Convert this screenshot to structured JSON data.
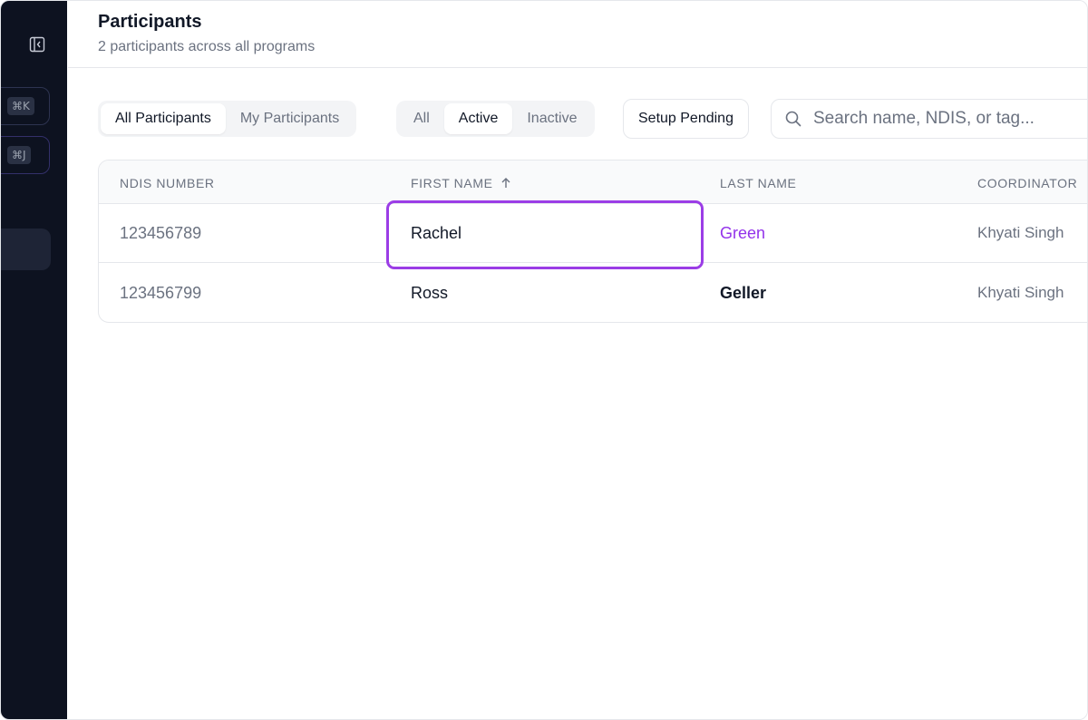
{
  "sidebar": {
    "shortcut_k": "⌘K",
    "shortcut_j": "⌘J"
  },
  "header": {
    "title": "Participants",
    "subtitle": "2 participants across all programs"
  },
  "filters": {
    "scope": [
      {
        "label": "All Participants",
        "active": true
      },
      {
        "label": "My Participants",
        "active": false
      }
    ],
    "status": [
      {
        "label": "All",
        "active": false
      },
      {
        "label": "Active",
        "active": true
      },
      {
        "label": "Inactive",
        "active": false
      }
    ],
    "setup_pending_label": "Setup Pending",
    "search_placeholder": "Search name, NDIS, or tag..."
  },
  "table": {
    "columns": [
      "NDIS NUMBER",
      "FIRST NAME",
      "LAST NAME",
      "COORDINATOR"
    ],
    "sort_column": "FIRST NAME",
    "sort_direction": "ascending",
    "rows": [
      {
        "ndis": "123456789",
        "first_name": "Rachel",
        "last_name": "Green",
        "coordinator": "Khyati Singh"
      },
      {
        "ndis": "123456799",
        "first_name": "Ross",
        "last_name": "Geller",
        "coordinator": "Khyati Singh"
      }
    ]
  },
  "colors": {
    "sidebar_bg": "#0d1220",
    "accent_purple": "#9333ea",
    "highlight_border": "#9b3de6"
  }
}
